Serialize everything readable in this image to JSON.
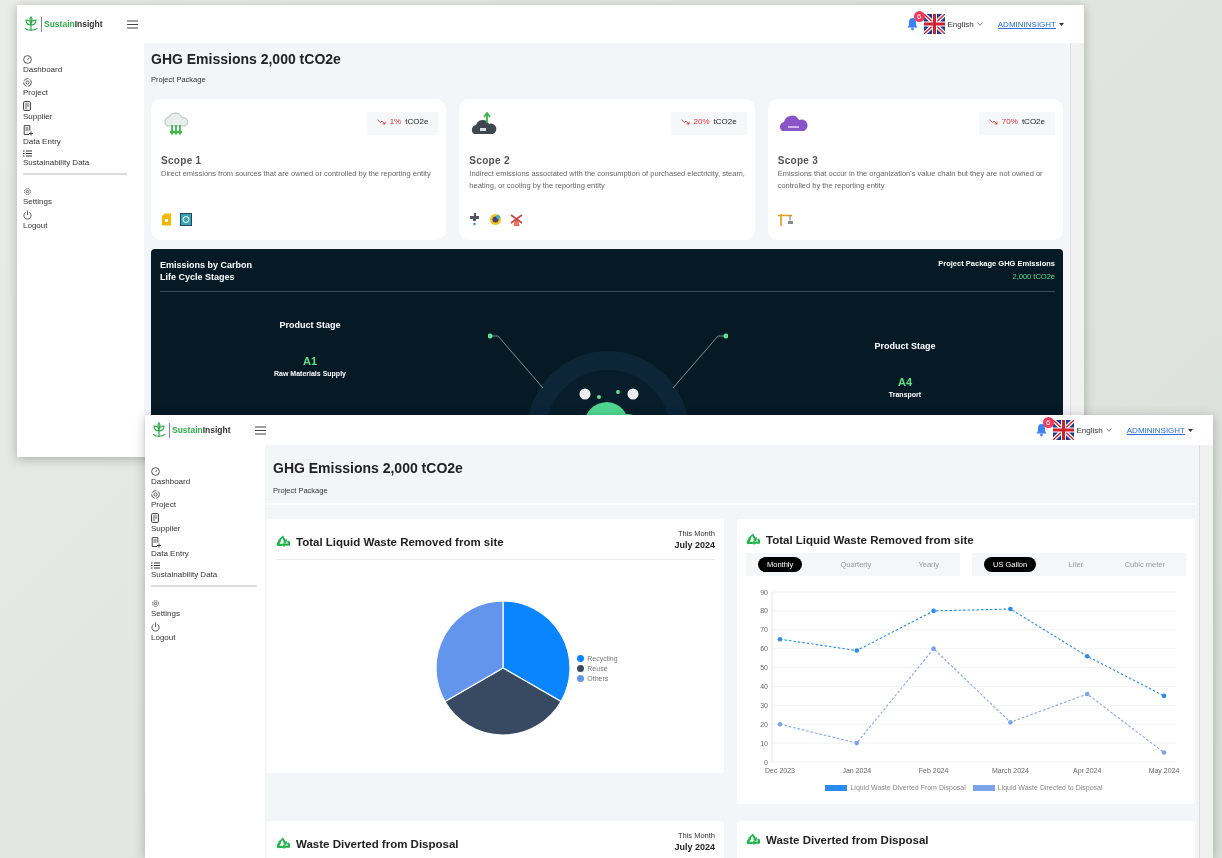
{
  "back_window": {
    "header": {
      "brand_first": "Sustain",
      "brand_second": "Insight",
      "notifications": "6",
      "language": "English",
      "user": "ADMININSIGHT"
    },
    "sidebar": {
      "items": [
        {
          "label": "Dashboard"
        },
        {
          "label": "Project"
        },
        {
          "label": "Supplier"
        },
        {
          "label": "Data Entry"
        },
        {
          "label": "Sustainability Data"
        }
      ],
      "bottom_items": [
        {
          "label": "Settings"
        },
        {
          "label": "Logout"
        }
      ]
    },
    "page": {
      "title": "GHG Emissions 2,000 tCO2e",
      "subtitle": "Project Package"
    },
    "scope_cards": [
      {
        "title": "Scope 1",
        "description": "Direct emissions from sources that are owned or controlled by the reporting entity",
        "decreasing": true,
        "change": "1%",
        "unit": "tCO2e"
      },
      {
        "title": "Scope 2",
        "description": "Indirect emissions associated with the consumption of purchased electricity, steam, heating, or cooling by the reporting entity",
        "decreasing": true,
        "change": "20%",
        "unit": "tCO2e"
      },
      {
        "title": "Scope 3",
        "description": "Emissions that occur in the organization's value chain but they are not owned or controlled by the reporting entity",
        "decreasing": true,
        "change": "70%",
        "unit": "tCO2e"
      }
    ],
    "lifecycle_panel": {
      "title": "Emissions by Carbon Life Cycle Stages",
      "total_label": "Project Package GHG Emissions",
      "total_value": "2,000 tCO2e",
      "left_stage": {
        "title": "Product Stage",
        "code": "A1",
        "name": "Raw Materials Supply"
      },
      "right_stage": {
        "title": "Product Stage",
        "code": "A4",
        "name": "Transport"
      }
    }
  },
  "front_window": {
    "header": {
      "brand_first": "Sustain",
      "brand_second": "Insight",
      "notifications": "6",
      "language": "English",
      "user": "ADMININSIGHT"
    },
    "sidebar": {
      "items": [
        {
          "label": "Dashboard"
        },
        {
          "label": "Project"
        },
        {
          "label": "Supplier"
        },
        {
          "label": "Data Entry"
        },
        {
          "label": "Sustainability Data"
        }
      ],
      "bottom_items": [
        {
          "label": "Settings"
        },
        {
          "label": "Logout"
        }
      ]
    },
    "page": {
      "title": "GHG Emissions 2,000 tCO2e",
      "subtitle": "Project Package"
    },
    "pie_card": {
      "title": "Total Liquid Waste Removed from site",
      "period_label": "This Month",
      "period": "July 2024",
      "legend": [
        {
          "label": "Recycling",
          "color": "#0a84ff"
        },
        {
          "label": "Reuse",
          "color": "#384a62"
        },
        {
          "label": "Others",
          "color": "#6495ed"
        }
      ]
    },
    "trend_card": {
      "title": "Total Liquid Waste Removed from site",
      "period_tabs": [
        {
          "label": "Monthly",
          "selected": true
        },
        {
          "label": "Quarterly",
          "selected": false
        },
        {
          "label": "Yearly",
          "selected": false
        }
      ],
      "unit_tabs": [
        {
          "label": "US Gallon",
          "selected": true
        },
        {
          "label": "Liter",
          "selected": false
        },
        {
          "label": "Cubic meter",
          "selected": false
        }
      ],
      "chart_data": {
        "type": "line",
        "categories": [
          "Dec 2023",
          "Jan 2024",
          "Feb 2024",
          "March 2024",
          "Apr 2024",
          "May 2024"
        ],
        "ylim": [
          0,
          90
        ],
        "yticks": [
          0,
          10,
          20,
          30,
          40,
          50,
          60,
          70,
          80,
          90
        ],
        "grid": true,
        "series": [
          {
            "name": "Liquid Waste Diverted From Disposal",
            "color": "#2b8cf0",
            "line_style": "dashed",
            "values": [
              65,
              59,
              80,
              81,
              56,
              35
            ]
          },
          {
            "name": "Liquid Waste Directed to Disposal",
            "color": "#7aa3ea",
            "line_style": "dashed",
            "values": [
              20,
              10,
              60,
              21,
              36,
              5
            ]
          }
        ]
      }
    },
    "diverted_card": {
      "title": "Waste Diverted from Disposal",
      "period_label": "This Month",
      "period": "July 2024"
    },
    "diverted_trend_card": {
      "title": "Waste Diverted from Disposal"
    }
  }
}
